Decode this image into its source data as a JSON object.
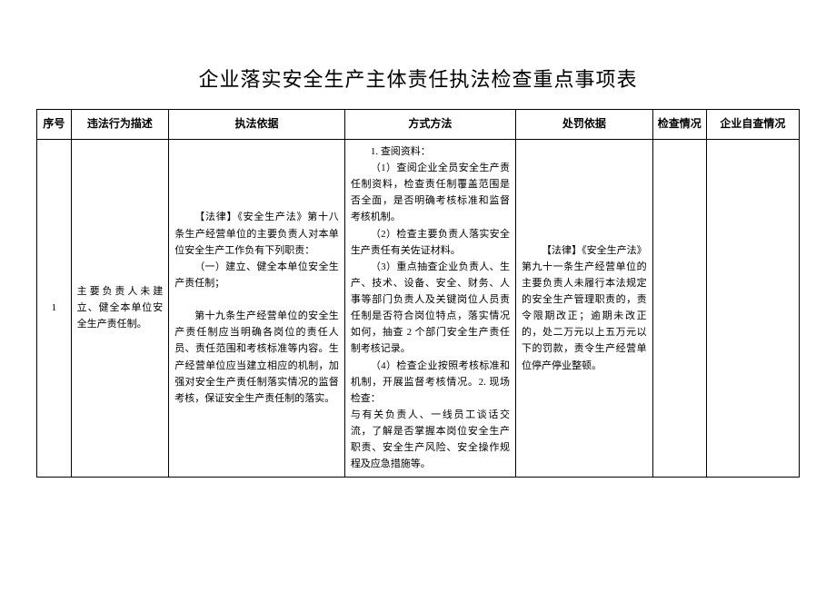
{
  "title": "企业落实安全生产主体责任执法检查重点事项表",
  "columns": {
    "seq": "序号",
    "desc": "违法行为描述",
    "basis": "执法依据",
    "method": "方式方法",
    "penalty": "处罚依据",
    "check": "检查情况",
    "self": "企业自查情况"
  },
  "rows": [
    {
      "seq": "1",
      "desc": "主要负责人未建立、健全本单位安全生产责任制。",
      "basis_p1": "【法律】《安全生产法》第十八条生产经营单位的主要负责人对本单位安全生产工作负有下列职责：",
      "basis_p2": "（一）建立、健全本单位安全生产责任制；",
      "basis_p3": "第十九条生产经营单位的安全生产责任制应当明确各岗位的责任人员、责任范围和考核标准等内容。生产经营单位应当建立相应的机制，加强对安全生产责任制落实情况的监督考核，保证安全生产责任制的落实。",
      "method_intro": "1. 查阅资料：",
      "method_1": "（1）查阅企业全员安全生产责任制资料，检查责任制覆盖范围是否全面，是否明确考核标准和监督考核机制。",
      "method_2": "（2）检查主要负责人落实安全生产责任有关佐证材料。",
      "method_3": "（3）重点抽查企业负责人、生产、技术、设备、安全、财务、人事等部门负责人及关键岗位人员责任制是否符合岗位特点，落实情况如何，抽查 2 个部门安全生产责任制考核记录。",
      "method_4": "（4）检查企业按照考核标准和机制，开展监督考核情况。2. 现场检查：",
      "method_5": "与有关负责人、一线员工谈话交流，了解是否掌握本岗位安全生产职责、安全生产风险、安全操作规程及应急措施等。",
      "penalty": "【法律】《安全生产法》第九十一条生产经营单位的主要负责人未履行本法规定的安全生产管理职责的，责令限期改正；逾期未改正的，处二万元以上五万元以下的罚款，责令生产经营单位停产停业整顿。",
      "check": "",
      "self": ""
    }
  ]
}
